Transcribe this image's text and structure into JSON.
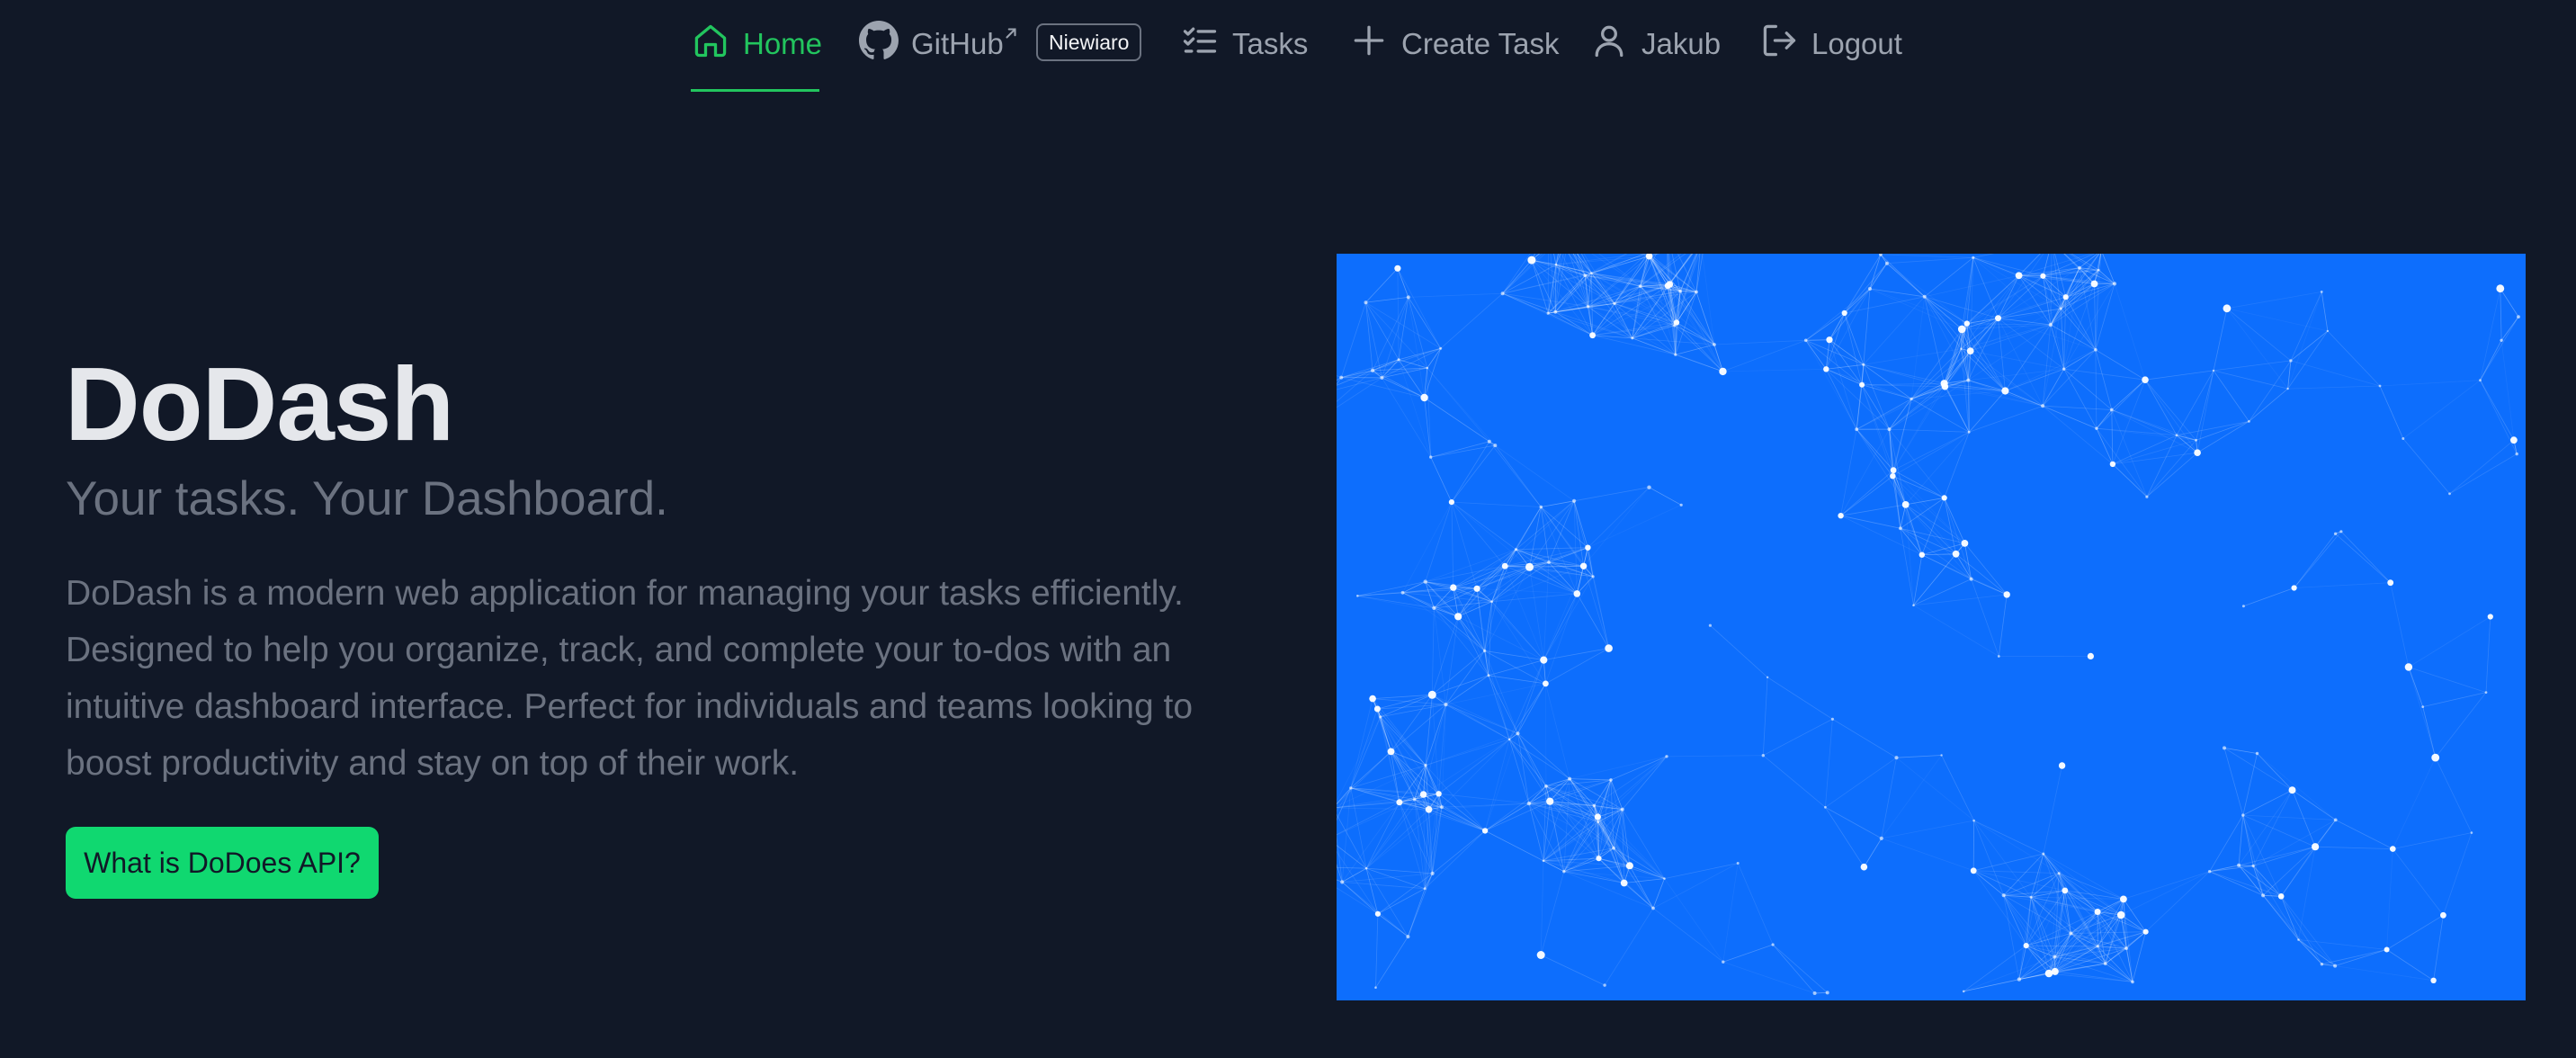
{
  "nav": {
    "home": "Home",
    "github": "GitHub",
    "github_badge": "Niewiaro",
    "tasks": "Tasks",
    "create_task": "Create Task",
    "user": "Jakub",
    "logout": "Logout"
  },
  "hero": {
    "title": "DoDash",
    "subtitle": "Your tasks. Your Dashboard.",
    "description": "DoDash is a modern web application for managing your tasks efficiently. Designed to help you organize, track, and complete your to-dos with an intuitive dashboard interface. Perfect for individuals and teams looking to boost productivity and stay on top of their work.",
    "cta_label": "What is DoDoes API?"
  },
  "image": {
    "background_color": "#0d6efd",
    "subject": "network-plexus"
  },
  "colors": {
    "page_background": "#111827",
    "accent": "#22c55e",
    "button": "#10d870",
    "muted_text": "#6b7280",
    "nav_text": "#9ca3af"
  },
  "icons": {
    "home": "home-icon",
    "github": "github-icon",
    "external": "external-link-icon",
    "tasks": "tasks-icon",
    "create": "plus-icon",
    "user": "user-icon",
    "logout": "logout-icon"
  }
}
